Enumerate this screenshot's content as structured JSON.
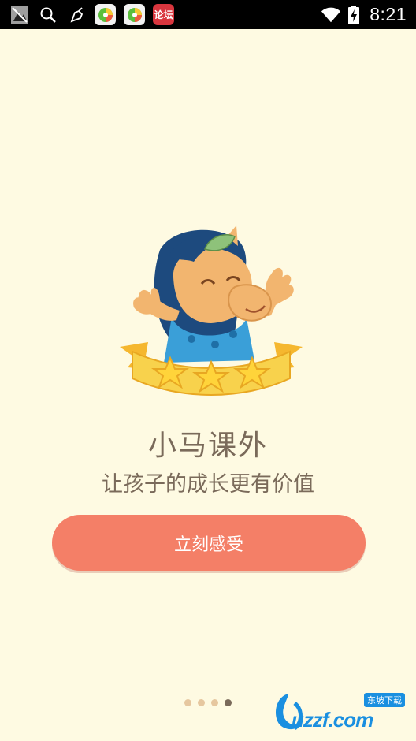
{
  "status_bar": {
    "time": "8:21",
    "icons": [
      "screenshot-icon",
      "search-icon",
      "broom-icon",
      "app-360-icon",
      "app-360-icon",
      "forum-app-icon",
      "wifi-icon",
      "battery-charging-icon"
    ],
    "forum_app_label": "论坛"
  },
  "splash": {
    "app_name": "小马课外",
    "tagline": "让孩子的成长更有价值",
    "cta_label": "立刻感受",
    "star_count": 3,
    "page_indicator": {
      "total": 4,
      "current": 4
    }
  },
  "watermark": {
    "brand": "uzzf.com",
    "label": "东坡下载"
  },
  "colors": {
    "background": "#fefae2",
    "cta": "#f47f67",
    "text": "#7a6a5a",
    "dot_inactive": "#e6c79f",
    "dot_active": "#7a6a5a"
  }
}
